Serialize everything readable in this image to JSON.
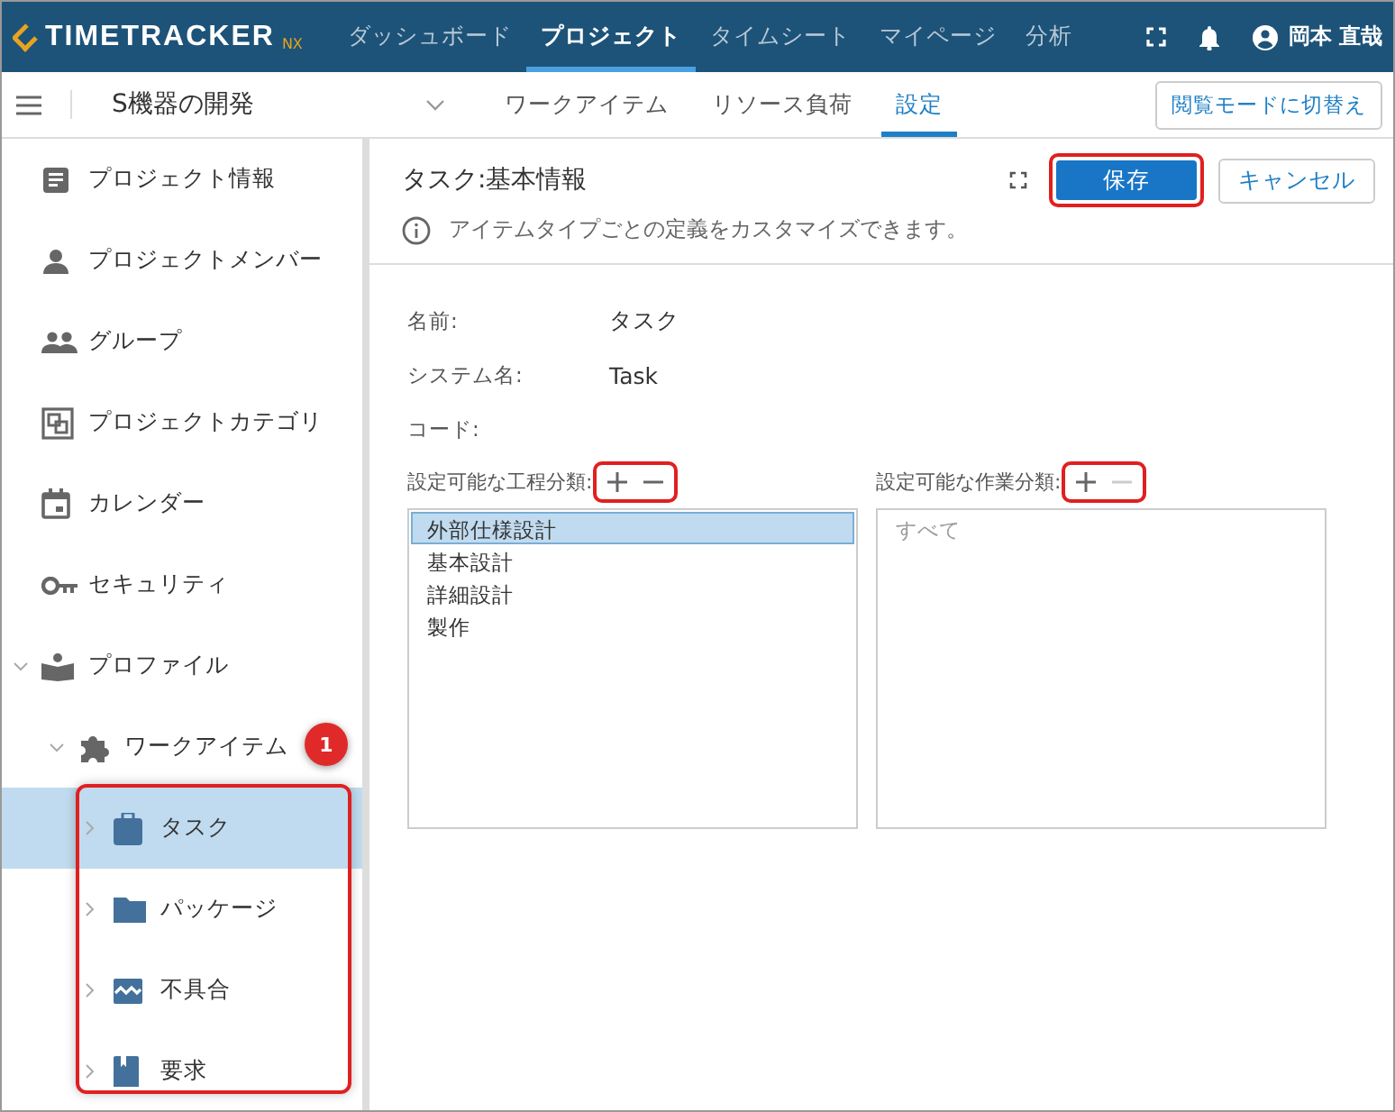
{
  "header": {
    "logo": "TIMETRACKER",
    "logo_suffix": "NX",
    "nav": [
      {
        "label": "ダッシュボード",
        "selected": false
      },
      {
        "label": "プロジェクト",
        "selected": true
      },
      {
        "label": "タイムシート",
        "selected": false
      },
      {
        "label": "マイページ",
        "selected": false
      },
      {
        "label": "分析",
        "selected": false
      }
    ],
    "user": "岡本 直哉"
  },
  "subbar": {
    "project": "S機器の開発",
    "tabs": [
      {
        "label": "ワークアイテム",
        "selected": false
      },
      {
        "label": "リソース負荷",
        "selected": false
      },
      {
        "label": "設定",
        "selected": true
      }
    ],
    "mode_button": "閲覧モードに切替え"
  },
  "sidebar": {
    "items": [
      {
        "label": "プロジェクト情報",
        "kind": "doc",
        "selected": false
      },
      {
        "label": "プロジェクトメンバー",
        "kind": "person",
        "selected": false
      },
      {
        "label": "グループ",
        "kind": "group",
        "selected": false
      },
      {
        "label": "プロジェクトカテゴリ",
        "kind": "category",
        "selected": false
      },
      {
        "label": "カレンダー",
        "kind": "calendar",
        "selected": false
      },
      {
        "label": "セキュリティ",
        "kind": "key",
        "selected": false
      },
      {
        "label": "プロファイル",
        "kind": "book",
        "selected": false,
        "expanded": true,
        "children": [
          {
            "label": "ワークアイテム",
            "kind": "puzzle",
            "selected": false,
            "expanded": true,
            "children": [
              {
                "label": "タスク",
                "kind": "clipboard",
                "selected": true,
                "expanded": false
              },
              {
                "label": "パッケージ",
                "kind": "folder",
                "selected": false,
                "expanded": false
              },
              {
                "label": "不具合",
                "kind": "bug",
                "selected": false,
                "expanded": false
              },
              {
                "label": "要求",
                "kind": "bookmark",
                "selected": false,
                "expanded": false
              }
            ]
          }
        ]
      }
    ]
  },
  "panel": {
    "title": "タスク:基本情報",
    "save": "保存",
    "cancel": "キャンセル",
    "info": "アイテムタイプごとの定義をカスタマイズできます。",
    "fields": [
      {
        "label": "名前:",
        "value": "タスク"
      },
      {
        "label": "システム名:",
        "value": "Task"
      },
      {
        "label": "コード:"
      }
    ],
    "lists": [
      {
        "label": "設定可能な工程分類:",
        "remove_disabled": false,
        "items": [
          {
            "label": "外部仕様設計",
            "selected": true
          },
          {
            "label": "基本設計",
            "selected": false
          },
          {
            "label": "詳細設計",
            "selected": false
          },
          {
            "label": "製作",
            "selected": false
          }
        ]
      },
      {
        "label": "設定可能な作業分類:",
        "remove_disabled": true,
        "items": [
          {
            "label": "すべて",
            "selected": false,
            "disabled": true
          }
        ]
      }
    ]
  },
  "annotation": {
    "badge": "1"
  }
}
